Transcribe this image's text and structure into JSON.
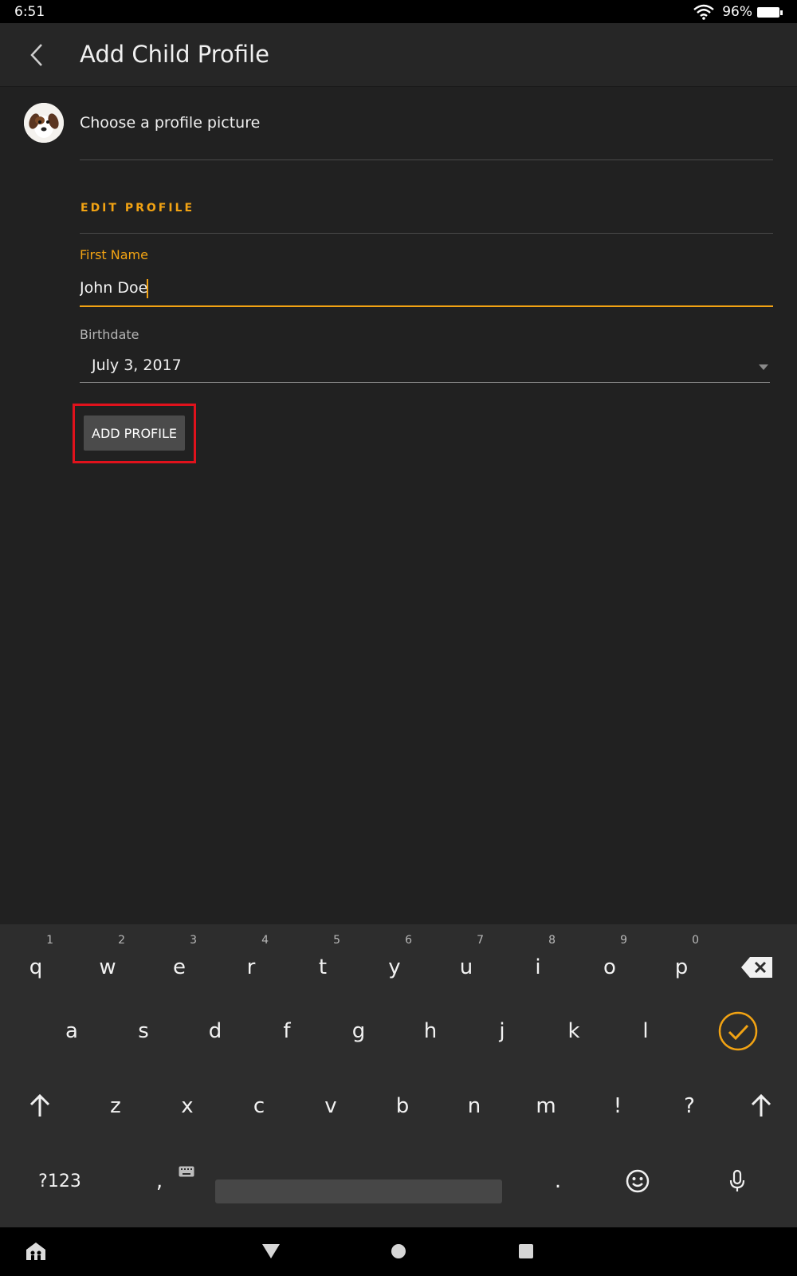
{
  "status_bar": {
    "time": "6:51",
    "battery": "96%"
  },
  "app_bar": {
    "title": "Add Child Profile"
  },
  "profile_picture": {
    "label": "Choose a profile picture"
  },
  "section": {
    "heading": "EDIT PROFILE"
  },
  "form": {
    "first_name_label": "First Name",
    "first_name_value": "John Doe",
    "birthdate_label": "Birthdate",
    "birthdate_value": "July 3, 2017",
    "add_button_label": "ADD PROFILE"
  },
  "keyboard": {
    "row1": [
      {
        "key": "q",
        "hint": "1"
      },
      {
        "key": "w",
        "hint": "2"
      },
      {
        "key": "e",
        "hint": "3"
      },
      {
        "key": "r",
        "hint": "4"
      },
      {
        "key": "t",
        "hint": "5"
      },
      {
        "key": "y",
        "hint": "6"
      },
      {
        "key": "u",
        "hint": "7"
      },
      {
        "key": "i",
        "hint": "8"
      },
      {
        "key": "o",
        "hint": "9"
      },
      {
        "key": "p",
        "hint": "0"
      }
    ],
    "row2": [
      "a",
      "s",
      "d",
      "f",
      "g",
      "h",
      "j",
      "k",
      "l"
    ],
    "row3": [
      "z",
      "x",
      "c",
      "v",
      "b",
      "n",
      "m",
      "!",
      "?"
    ],
    "symbols_key": "?123",
    "comma_key": ",",
    "period_key": "."
  },
  "colors": {
    "accent": "#f2a313",
    "highlight": "#e0121c",
    "background": "#212121"
  },
  "icons": [
    "wifi-icon",
    "battery-icon",
    "back-arrow-icon",
    "avatar-puppy-icon",
    "dropdown-arrow-icon",
    "backspace-icon",
    "done-check-icon",
    "shift-icon",
    "keyboard-switch-icon",
    "emoji-icon",
    "mic-icon",
    "kids-home-icon",
    "nav-back-icon",
    "nav-home-icon",
    "nav-recents-icon"
  ]
}
